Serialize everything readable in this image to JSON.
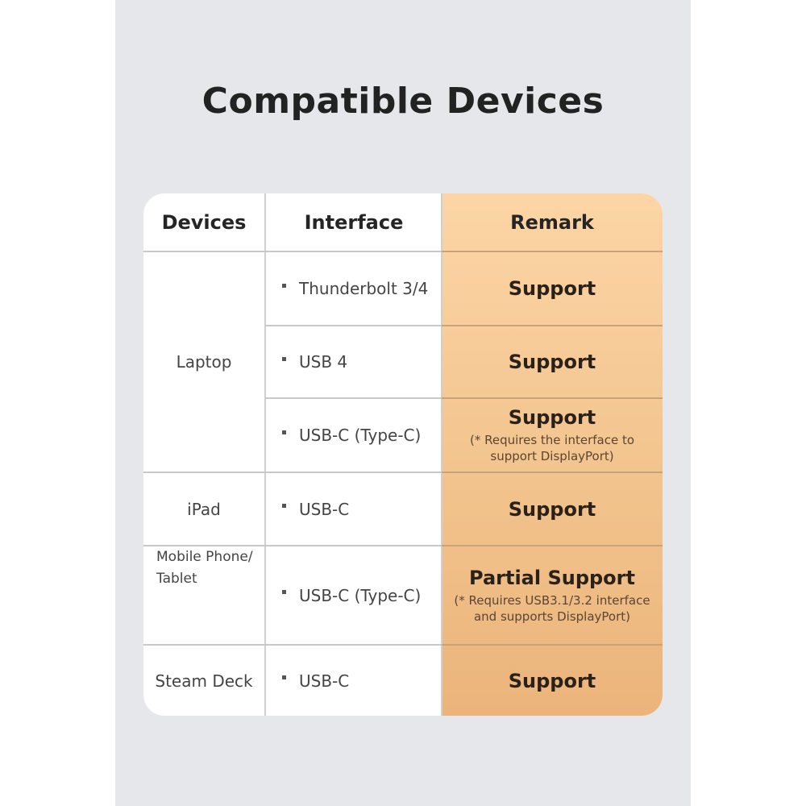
{
  "page": {
    "title": "Compatible Devices"
  },
  "table": {
    "headers": {
      "devices": "Devices",
      "interface": "Interface",
      "remark": "Remark"
    },
    "devices": [
      {
        "name": "Laptop"
      },
      {
        "name": "iPad"
      },
      {
        "name": "Mobile Phone/ Tablet",
        "line1": "Mobile Phone/",
        "line2": "Tablet"
      },
      {
        "name": "Steam Deck"
      }
    ],
    "rows": [
      {
        "device": "Laptop",
        "interface": "Thunderbolt 3/4",
        "remark": "Support",
        "note": ""
      },
      {
        "device": "Laptop",
        "interface": "USB 4",
        "remark": "Support",
        "note": ""
      },
      {
        "device": "Laptop",
        "interface": "USB-C (Type-C)",
        "remark": "Support",
        "note_line1": "(* Requires the interface to",
        "note_line2": "support DisplayPort)"
      },
      {
        "device": "iPad",
        "interface": "USB-C",
        "remark": "Support",
        "note": ""
      },
      {
        "device": "Mobile Phone/ Tablet",
        "interface": "USB-C (Type-C)",
        "remark": "Partial Support",
        "note_line1": "(* Requires USB3.1/3.2 interface",
        "note_line2": "and supports DisplayPort)"
      },
      {
        "device": "Steam Deck",
        "interface": "USB-C",
        "remark": "Support",
        "note": ""
      }
    ]
  },
  "colors": {
    "background": "#e6e7eb",
    "remark_column_top": "#fcd5a6",
    "remark_column_bottom": "#ebb47b",
    "title_text": "#222222"
  }
}
